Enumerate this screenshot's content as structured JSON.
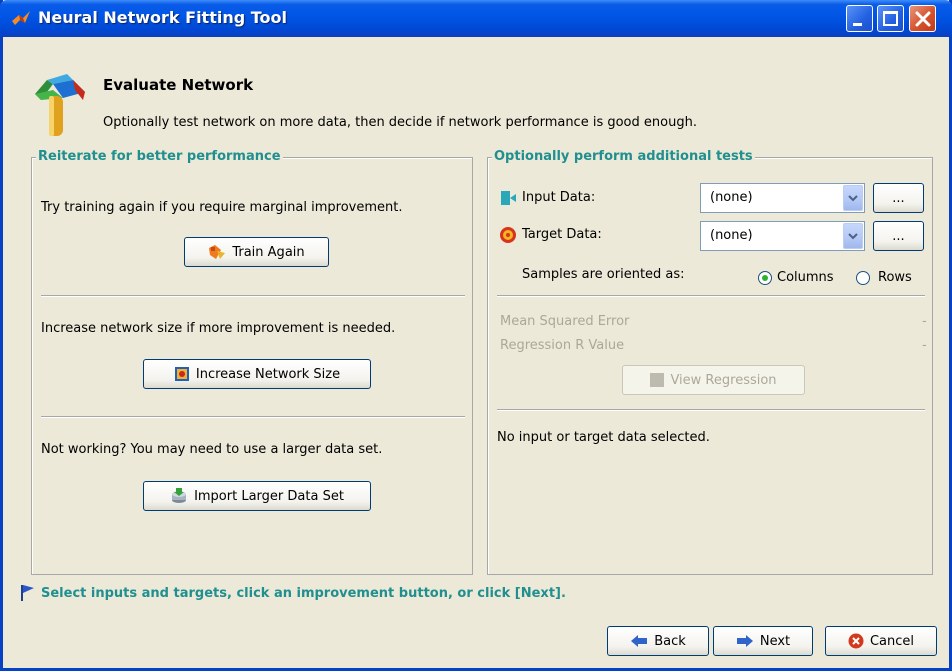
{
  "window": {
    "title": "Neural Network Fitting Tool"
  },
  "header": {
    "title": "Evaluate Network",
    "description": "Optionally test network on more data, then decide if network performance is good enough."
  },
  "left_panel": {
    "title": "Reiterate for better performance",
    "train_text": "Try training again if you require marginal improvement.",
    "train_button": "Train Again",
    "size_text": "Increase network size if more improvement is needed.",
    "size_button": "Increase Network Size",
    "data_text": "Not working? You may need to use a larger data set.",
    "data_button": "Import Larger Data Set"
  },
  "right_panel": {
    "title": "Optionally perform additional tests",
    "input_label": "Input Data:",
    "input_value": "(none)",
    "target_label": "Target Data:",
    "target_value": "(none)",
    "browse_label": "...",
    "orientation_label": "Samples are oriented as:",
    "columns_label": "Columns",
    "rows_label": "Rows",
    "orientation_selected": "Columns",
    "mse_label": "Mean Squared Error",
    "mse_value": "-",
    "r_label": "Regression R Value",
    "r_value": "-",
    "view_regression_button": "View Regression",
    "message": "No input or target data selected."
  },
  "status": "Select inputs and targets, click an improvement button, or click [Next].",
  "footer": {
    "back": "Back",
    "next": "Next",
    "cancel": "Cancel"
  },
  "colors": {
    "accent": "#1f8f8f",
    "titlebar": "#0055e5",
    "panel_bg": "#ece9d8"
  }
}
